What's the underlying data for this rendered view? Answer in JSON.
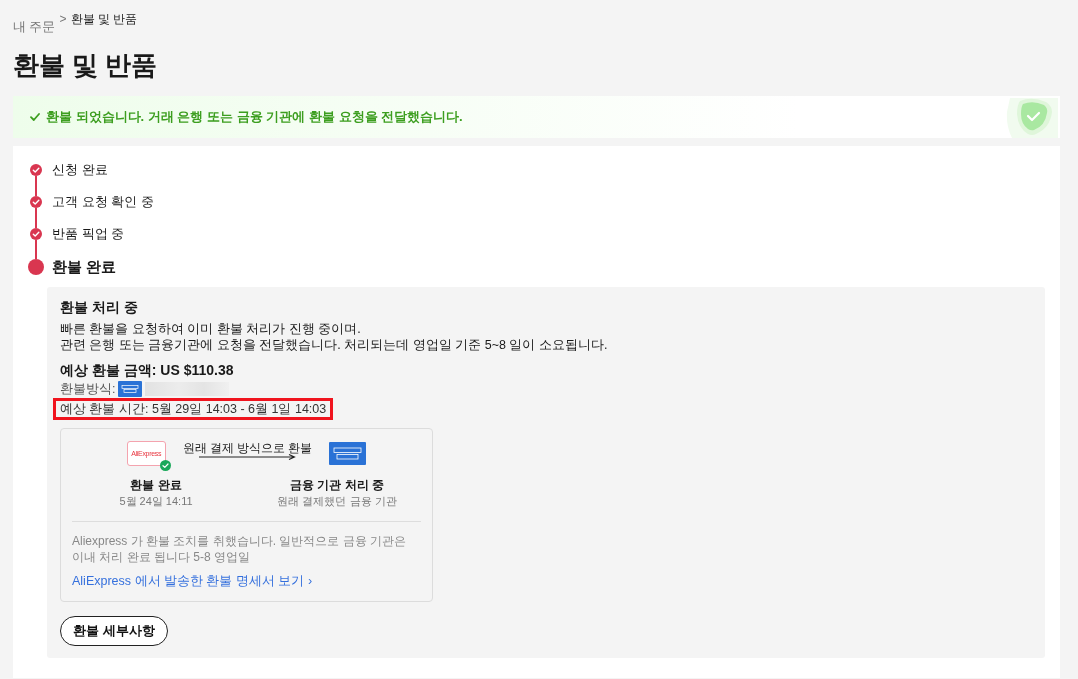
{
  "breadcrumb": {
    "separator": ">",
    "items": [
      {
        "label": "내 주문",
        "link": true
      },
      {
        "label": "환불 및 반품",
        "link": false
      }
    ]
  },
  "title": "환불 및 반품",
  "banner": {
    "message": "환불 되었습니다. 거래 은행 또는 금융 기관에 환불 요청을 전달했습니다."
  },
  "steps": [
    {
      "label": "신청 완료",
      "current": false
    },
    {
      "label": "고객 요청 확인 중",
      "current": false
    },
    {
      "label": "반품 픽업 중",
      "current": false
    },
    {
      "label": "환불 완료",
      "current": true
    }
  ],
  "refund": {
    "heading": "환불 처리 중",
    "description": [
      "빠른 환불을 요청하여 이미 환불 처리가 진행 중이며.",
      "관련 은행 또는 금융기관에 요청을 전달했습니다. 처리되는데 영업일 기준 5~8 일이 소요됩니다."
    ],
    "amount": "예상 환불 금액: US $110.38",
    "method_label": "환불방식:",
    "time": {
      "text": "예상 환불 시간: 5월 29일 14:03 - 6월 1일 14:03",
      "highlighted": true
    }
  },
  "flow": {
    "label": "원래 결제 방식으로 환불",
    "nodes": [
      {
        "kind": "merchant",
        "logo_text": "AliExpress",
        "title": "환불 완료",
        "subtitle": "5월 24일 14:11",
        "done": true
      },
      {
        "kind": "card",
        "title": "금융 기관 처리 중",
        "subtitle": "원래 결제했던 금융 기관",
        "done": false
      }
    ],
    "note": "Aliexpress 가 환불 조치를 취했습니다. 일반적으로 금융 기관은 이내 처리 완료 됩니다 5-8 영업일",
    "link": "AliExpress 에서 발송한 환불 명세서 보기 ›"
  },
  "details_button": "환불 세부사항"
}
